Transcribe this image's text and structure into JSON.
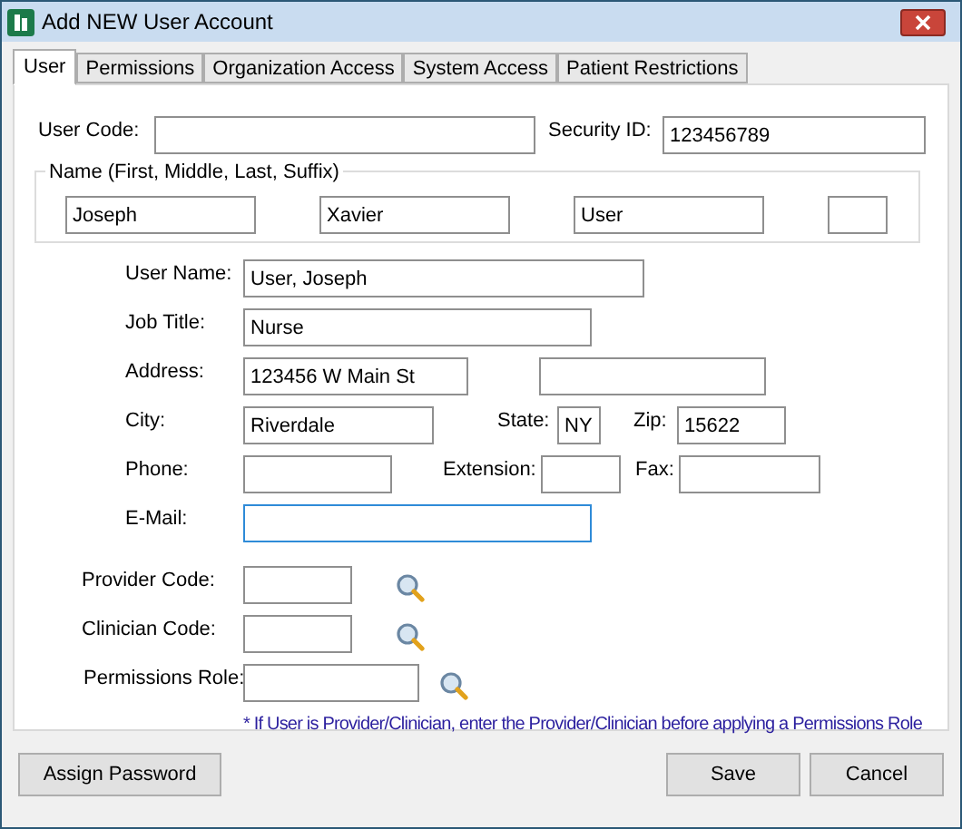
{
  "window": {
    "title": "Add NEW User Account"
  },
  "tabs": [
    {
      "label": "User",
      "selected": true
    },
    {
      "label": "Permissions",
      "selected": false
    },
    {
      "label": "Organization Access",
      "selected": false
    },
    {
      "label": "System Access",
      "selected": false
    },
    {
      "label": "Patient Restrictions",
      "selected": false
    }
  ],
  "user_code": {
    "label": "User Code:"
  },
  "security_id": {
    "label": "Security ID:",
    "value": "123456789"
  },
  "name_group": {
    "legend": "Name (First, Middle, Last, Suffix)",
    "fields": [
      {
        "kind": "name",
        "value": "Joseph"
      },
      {
        "kind": "name",
        "value": "Xavier"
      },
      {
        "kind": "name",
        "value": "User"
      },
      {
        "kind": "suffix"
      }
    ]
  },
  "user_name": {
    "label": "User Name:",
    "value": "User, Joseph"
  },
  "job_title": {
    "label": "Job Title:",
    "value": "Nurse"
  },
  "address": {
    "label": "Address:",
    "line_1": "123456 W Main St"
  },
  "city": {
    "label": "City:",
    "value": "Riverdale"
  },
  "state": {
    "label": "State:",
    "value": "NY"
  },
  "zip": {
    "label": "Zip:",
    "value": "15622"
  },
  "phone": {
    "label": "Phone:"
  },
  "extension": {
    "label": "Extension:"
  },
  "fax": {
    "label": "Fax:"
  },
  "email": {
    "label": "E-Mail:",
    "focused": true
  },
  "provider_code": {
    "label": "Provider Code:"
  },
  "clinician_code": {
    "label": "Clinician Code:"
  },
  "permissions_role": {
    "label": "Permissions Role:"
  },
  "note": "* If User is Provider/Clinician, enter the Provider/Clinician before applying a Permissions Role",
  "buttons": {
    "assign_password": "Assign Password",
    "save": "Save",
    "cancel": "Cancel"
  }
}
